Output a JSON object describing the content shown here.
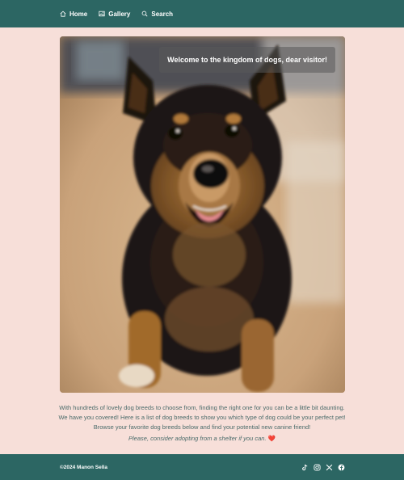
{
  "nav": {
    "items": [
      {
        "label": "Home",
        "icon": "home-icon"
      },
      {
        "label": "Gallery",
        "icon": "gallery-icon"
      },
      {
        "label": "Search",
        "icon": "search-icon"
      }
    ]
  },
  "hero": {
    "welcome_text": "Welcome to the kingdom of dogs, dear visitor!"
  },
  "intro": {
    "line1": "With hundreds of lovely dog breeds to choose from, finding the right one for you can be a little bit daunting.",
    "line2": "We have you covered! Here is a list of dog breeds to show you which type of dog could be your perfect pet!",
    "line3": "Browse your favorite dog breeds below and find your potential new canine friend!",
    "adopt_text": "Please, consider adopting from a shelter if you can.",
    "heart_glyph": "❤️"
  },
  "footer": {
    "copyright": "©2024 Manon Sella",
    "socials": [
      "tiktok-icon",
      "instagram-icon",
      "x-icon",
      "facebook-icon"
    ]
  },
  "colors": {
    "background": "#f7dfd9",
    "nav_bg": "#2c6663",
    "text": "#4a6b6a",
    "heart": "#d63b4b"
  }
}
